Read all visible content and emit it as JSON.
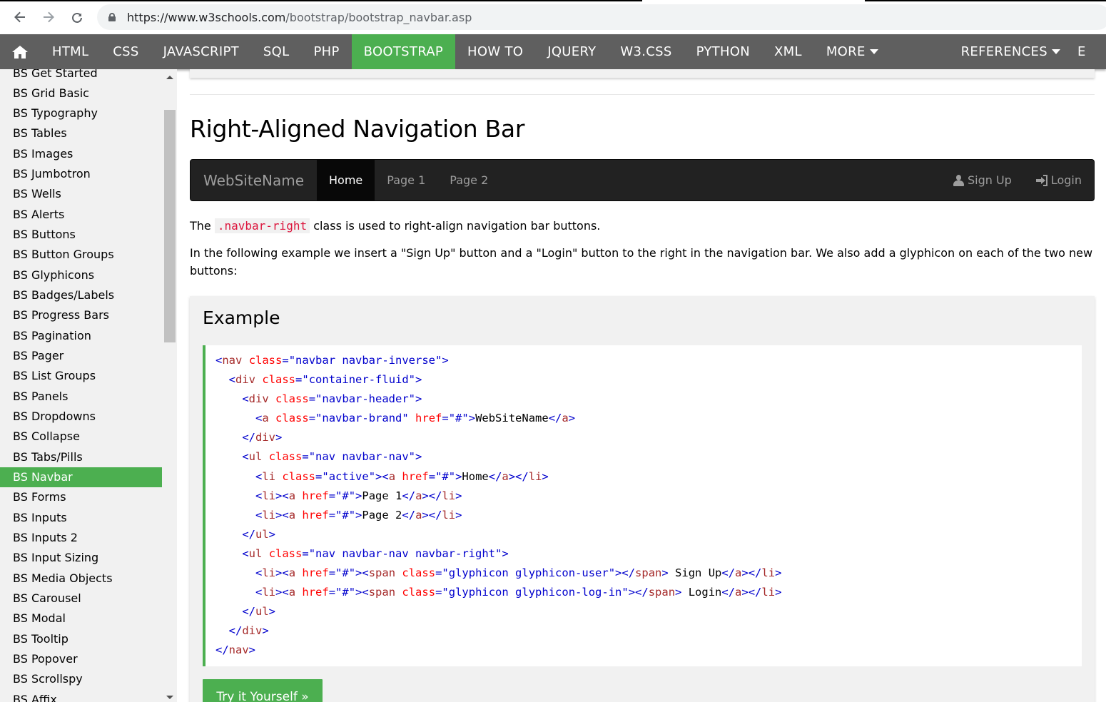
{
  "browser": {
    "url_host": "https://www.w3schools.com",
    "url_path": "/bootstrap/bootstrap_navbar.asp"
  },
  "topnav": {
    "items": [
      "HTML",
      "CSS",
      "JAVASCRIPT",
      "SQL",
      "PHP",
      "BOOTSTRAP",
      "HOW TO",
      "JQUERY",
      "W3.CSS",
      "PYTHON",
      "XML",
      "MORE",
      "REFERENCES",
      "E"
    ],
    "active": "BOOTSTRAP"
  },
  "sidebar": {
    "items": [
      "BS Get Started",
      "BS Grid Basic",
      "BS Typography",
      "BS Tables",
      "BS Images",
      "BS Jumbotron",
      "BS Wells",
      "BS Alerts",
      "BS Buttons",
      "BS Button Groups",
      "BS Glyphicons",
      "BS Badges/Labels",
      "BS Progress Bars",
      "BS Pagination",
      "BS Pager",
      "BS List Groups",
      "BS Panels",
      "BS Dropdowns",
      "BS Collapse",
      "BS Tabs/Pills",
      "BS Navbar",
      "BS Forms",
      "BS Inputs",
      "BS Inputs 2",
      "BS Input Sizing",
      "BS Media Objects",
      "BS Carousel",
      "BS Modal",
      "BS Tooltip",
      "BS Popover",
      "BS Scrollspy",
      "BS Affix"
    ],
    "active": "BS Navbar"
  },
  "main": {
    "title": "Right-Aligned Navigation Bar",
    "demo_nav": {
      "brand": "WebSiteName",
      "links": [
        "Home",
        "Page 1",
        "Page 2"
      ],
      "signup": "Sign Up",
      "login": "Login"
    },
    "para1_pre": "The",
    "para1_code": ".navbar-right",
    "para1_post": "class is used to right-align navigation bar buttons.",
    "para2": "In the following example we insert a \"Sign Up\" button and a \"Login\" button to the right in the navigation bar. We also add a glyphicon on each of the two new buttons:",
    "example_title": "Example",
    "try_button": "Try it Yourself »"
  },
  "colors": {
    "accent": "#4CAF50",
    "topnav_bg": "#5f5f5f",
    "navbar_inverse_bg": "#222222"
  }
}
